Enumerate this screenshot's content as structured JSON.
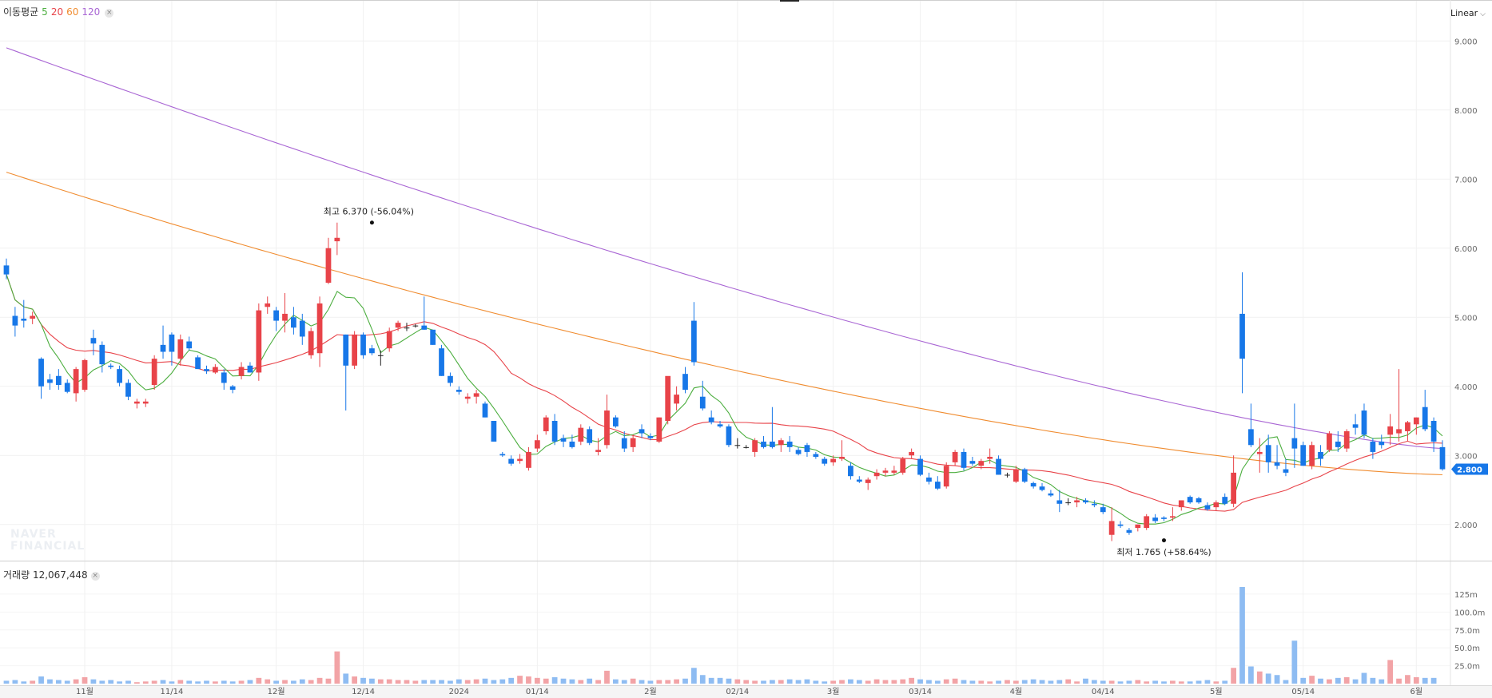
{
  "legend": {
    "label": "이동평균",
    "ma5": "5",
    "ma20": "20",
    "ma60": "60",
    "ma120": "120"
  },
  "volume_legend": {
    "label": "거래량",
    "value": "12,067,448"
  },
  "scale": {
    "label": "Linear"
  },
  "watermark": {
    "line1": "NAVER",
    "line2": "FINANCIAL"
  },
  "colors": {
    "up": "#e84349",
    "down": "#1777e8",
    "vol_up": "#f2a3a6",
    "vol_down": "#8ebcf2",
    "ma5": "#4cae3f",
    "ma20": "#e84349",
    "ma60": "#f08c30",
    "ma120": "#a966d4",
    "last_price_bg": "#1777e8"
  },
  "chart_data": {
    "type": "candlestick",
    "title": "",
    "price_axis": {
      "ylim": [
        1.5,
        9.5
      ],
      "ticks": [
        "2.000",
        "3.000",
        "4.000",
        "5.000",
        "6.000",
        "7.000",
        "8.000",
        "9.000"
      ]
    },
    "volume_axis": {
      "ylim": [
        0,
        145
      ],
      "ticks": [
        "25.0m",
        "50.0m",
        "75.0m",
        "100.0m",
        "125m"
      ]
    },
    "time_labels": [
      {
        "label": "11월",
        "index": 9
      },
      {
        "label": "11/14",
        "index": 19
      },
      {
        "label": "12월",
        "index": 31
      },
      {
        "label": "12/14",
        "index": 41
      },
      {
        "label": "2024",
        "index": 52
      },
      {
        "label": "01/14",
        "index": 61
      },
      {
        "label": "2월",
        "index": 74
      },
      {
        "label": "02/14",
        "index": 84
      },
      {
        "label": "3월",
        "index": 95
      },
      {
        "label": "03/14",
        "index": 105
      },
      {
        "label": "4월",
        "index": 116
      },
      {
        "label": "04/14",
        "index": 126
      },
      {
        "label": "5월",
        "index": 139
      },
      {
        "label": "05/14",
        "index": 149
      },
      {
        "label": "6월",
        "index": 162
      }
    ],
    "high_annotation": {
      "label": "최고 6.370 (-56.04%)",
      "index": 42,
      "value": 6.37
    },
    "low_annotation": {
      "label": "최저 1.765 (+58.64%)",
      "index": 133,
      "value": 1.765
    },
    "last_price": {
      "label": "2.800",
      "value": 2.8
    },
    "candles": [
      [
        5.75,
        5.85,
        5.55,
        5.62
      ],
      [
        5.02,
        5.15,
        4.72,
        4.88
      ],
      [
        4.98,
        5.25,
        4.85,
        4.95
      ],
      [
        4.98,
        5.08,
        4.9,
        5.02
      ],
      [
        4.4,
        4.42,
        3.82,
        4.0
      ],
      [
        4.1,
        4.18,
        3.95,
        4.05
      ],
      [
        4.15,
        4.25,
        3.95,
        4.02
      ],
      [
        4.05,
        4.1,
        3.9,
        3.92
      ],
      [
        3.9,
        4.28,
        3.78,
        4.25
      ],
      [
        3.95,
        4.4,
        3.92,
        4.38
      ],
      [
        4.7,
        4.82,
        4.45,
        4.62
      ],
      [
        4.6,
        4.65,
        4.2,
        4.32
      ],
      [
        4.3,
        4.33,
        4.25,
        4.28
      ],
      [
        4.25,
        4.3,
        4.0,
        4.05
      ],
      [
        4.05,
        4.1,
        3.8,
        3.85
      ],
      [
        3.75,
        3.82,
        3.68,
        3.78
      ],
      [
        3.75,
        3.82,
        3.7,
        3.78
      ],
      [
        4.02,
        4.45,
        3.95,
        4.4
      ],
      [
        4.6,
        4.88,
        4.4,
        4.5
      ],
      [
        4.75,
        4.78,
        4.3,
        4.5
      ],
      [
        4.4,
        4.75,
        4.3,
        4.68
      ],
      [
        4.65,
        4.72,
        4.52,
        4.55
      ],
      [
        4.42,
        4.45,
        4.25,
        4.25
      ],
      [
        4.25,
        4.3,
        4.18,
        4.22
      ],
      [
        4.2,
        4.32,
        4.18,
        4.28
      ],
      [
        4.2,
        4.25,
        3.95,
        4.05
      ],
      [
        4.0,
        4.02,
        3.9,
        3.95
      ],
      [
        4.15,
        4.35,
        4.1,
        4.28
      ],
      [
        4.3,
        4.35,
        4.2,
        4.2
      ],
      [
        4.2,
        5.2,
        4.08,
        5.1
      ],
      [
        5.15,
        5.3,
        5.05,
        5.2
      ],
      [
        5.1,
        5.15,
        4.8,
        4.95
      ],
      [
        4.95,
        5.35,
        4.78,
        5.05
      ],
      [
        5.0,
        5.15,
        4.75,
        4.85
      ],
      [
        4.95,
        5.05,
        4.6,
        4.72
      ],
      [
        4.45,
        4.85,
        4.4,
        4.8
      ],
      [
        4.48,
        5.3,
        4.28,
        5.2
      ],
      [
        5.5,
        6.15,
        5.48,
        6.0
      ],
      [
        6.1,
        6.37,
        5.9,
        6.15
      ],
      [
        4.75,
        4.75,
        3.65,
        4.3
      ],
      [
        4.3,
        4.8,
        4.25,
        4.75
      ],
      [
        4.75,
        4.78,
        4.4,
        4.45
      ],
      [
        4.55,
        4.6,
        4.45,
        4.48
      ],
      [
        4.45,
        4.52,
        4.3,
        4.45
      ],
      [
        4.55,
        4.85,
        4.5,
        4.8
      ],
      [
        4.85,
        4.95,
        4.8,
        4.92
      ],
      [
        4.85,
        4.92,
        4.8,
        4.85
      ],
      [
        4.88,
        4.9,
        4.85,
        4.88
      ],
      [
        4.88,
        5.3,
        4.82,
        4.82
      ],
      [
        4.82,
        4.82,
        4.6,
        4.6
      ],
      [
        4.55,
        4.6,
        4.15,
        4.15
      ],
      [
        4.15,
        4.2,
        4.0,
        4.05
      ],
      [
        3.95,
        4.0,
        3.88,
        3.92
      ],
      [
        3.82,
        3.9,
        3.75,
        3.85
      ],
      [
        3.85,
        3.95,
        3.75,
        3.9
      ],
      [
        3.75,
        3.78,
        3.55,
        3.55
      ],
      [
        3.5,
        3.5,
        3.2,
        3.2
      ],
      [
        3.02,
        3.05,
        2.98,
        3.0
      ],
      [
        2.95,
        3.0,
        2.85,
        2.88
      ],
      [
        2.92,
        3.02,
        2.88,
        2.95
      ],
      [
        2.82,
        3.12,
        2.78,
        3.05
      ],
      [
        3.1,
        3.3,
        3.05,
        3.22
      ],
      [
        3.35,
        3.58,
        3.3,
        3.55
      ],
      [
        3.5,
        3.6,
        3.15,
        3.2
      ],
      [
        3.25,
        3.3,
        3.12,
        3.2
      ],
      [
        3.2,
        3.3,
        3.1,
        3.12
      ],
      [
        3.2,
        3.45,
        3.15,
        3.4
      ],
      [
        3.38,
        3.42,
        3.15,
        3.18
      ],
      [
        3.05,
        3.25,
        3.0,
        3.08
      ],
      [
        3.15,
        3.88,
        3.1,
        3.65
      ],
      [
        3.55,
        3.58,
        3.4,
        3.42
      ],
      [
        3.25,
        3.35,
        3.05,
        3.1
      ],
      [
        3.12,
        3.3,
        3.05,
        3.25
      ],
      [
        3.38,
        3.45,
        3.25,
        3.32
      ],
      [
        3.28,
        3.32,
        3.22,
        3.25
      ],
      [
        3.2,
        3.55,
        3.18,
        3.55
      ],
      [
        3.5,
        4.0,
        3.45,
        4.15
      ],
      [
        3.75,
        4.0,
        3.65,
        3.88
      ],
      [
        4.18,
        4.28,
        3.9,
        3.95
      ],
      [
        4.95,
        5.22,
        4.3,
        4.35
      ],
      [
        3.85,
        4.08,
        3.65,
        3.68
      ],
      [
        3.55,
        3.65,
        3.45,
        3.48
      ],
      [
        3.45,
        3.5,
        3.4,
        3.42
      ],
      [
        3.42,
        3.45,
        3.12,
        3.15
      ],
      [
        3.15,
        3.25,
        3.1,
        3.15
      ],
      [
        3.12,
        3.15,
        3.1,
        3.12
      ],
      [
        3.05,
        3.25,
        2.98,
        3.22
      ],
      [
        3.2,
        3.28,
        3.1,
        3.12
      ],
      [
        3.2,
        3.7,
        3.1,
        3.12
      ],
      [
        3.15,
        3.25,
        3.05,
        3.22
      ],
      [
        3.2,
        3.28,
        3.05,
        3.12
      ],
      [
        3.08,
        3.12,
        3.0,
        3.02
      ],
      [
        3.15,
        3.18,
        2.98,
        3.05
      ],
      [
        3.02,
        3.05,
        2.95,
        2.98
      ],
      [
        2.95,
        2.98,
        2.85,
        2.88
      ],
      [
        2.9,
        3.0,
        2.85,
        2.95
      ],
      [
        2.95,
        3.22,
        2.92,
        2.98
      ],
      [
        2.85,
        2.9,
        2.65,
        2.7
      ],
      [
        2.65,
        2.7,
        2.6,
        2.62
      ],
      [
        2.6,
        2.68,
        2.5,
        2.65
      ],
      [
        2.7,
        2.8,
        2.65,
        2.75
      ],
      [
        2.75,
        2.82,
        2.7,
        2.78
      ],
      [
        2.75,
        2.85,
        2.72,
        2.78
      ],
      [
        2.75,
        2.98,
        2.72,
        2.95
      ],
      [
        3.0,
        3.1,
        2.95,
        3.05
      ],
      [
        2.95,
        3.0,
        2.7,
        2.72
      ],
      [
        2.68,
        2.75,
        2.58,
        2.62
      ],
      [
        2.62,
        2.7,
        2.5,
        2.52
      ],
      [
        2.55,
        2.9,
        2.52,
        2.85
      ],
      [
        2.9,
        3.08,
        2.85,
        3.05
      ],
      [
        3.05,
        3.1,
        2.78,
        2.82
      ],
      [
        2.92,
        2.98,
        2.85,
        2.88
      ],
      [
        2.85,
        2.95,
        2.8,
        2.92
      ],
      [
        2.95,
        3.1,
        2.88,
        2.98
      ],
      [
        2.95,
        3.0,
        2.72,
        2.72
      ],
      [
        2.72,
        2.75,
        2.68,
        2.72
      ],
      [
        2.62,
        2.85,
        2.6,
        2.8
      ],
      [
        2.8,
        2.82,
        2.6,
        2.62
      ],
      [
        2.6,
        2.62,
        2.52,
        2.55
      ],
      [
        2.55,
        2.6,
        2.48,
        2.5
      ],
      [
        2.45,
        2.5,
        2.4,
        2.42
      ],
      [
        2.35,
        2.5,
        2.18,
        2.3
      ],
      [
        2.32,
        2.38,
        2.28,
        2.32
      ],
      [
        2.32,
        2.4,
        2.25,
        2.35
      ],
      [
        2.35,
        2.38,
        2.3,
        2.32
      ],
      [
        2.3,
        2.35,
        2.25,
        2.28
      ],
      [
        2.25,
        2.3,
        2.15,
        2.18
      ],
      [
        1.85,
        2.25,
        1.76,
        2.05
      ],
      [
        2.0,
        2.05,
        1.95,
        1.98
      ],
      [
        1.92,
        1.95,
        1.85,
        1.88
      ],
      [
        1.95,
        2.0,
        1.9,
        2.0
      ],
      [
        1.95,
        2.15,
        1.92,
        2.12
      ],
      [
        2.1,
        2.15,
        2.02,
        2.05
      ],
      [
        2.1,
        2.12,
        2.05,
        2.08
      ],
      [
        2.1,
        2.25,
        2.05,
        2.12
      ],
      [
        2.25,
        2.35,
        2.2,
        2.35
      ],
      [
        2.4,
        2.42,
        2.3,
        2.32
      ],
      [
        2.38,
        2.4,
        2.3,
        2.32
      ],
      [
        2.28,
        2.32,
        2.2,
        2.22
      ],
      [
        2.25,
        2.35,
        2.2,
        2.32
      ],
      [
        2.4,
        2.45,
        2.28,
        2.3
      ],
      [
        2.3,
        3.0,
        2.25,
        2.75
      ],
      [
        5.05,
        5.65,
        3.9,
        4.4
      ],
      [
        3.38,
        3.75,
        3.12,
        3.15
      ],
      [
        3.02,
        3.25,
        2.75,
        3.05
      ],
      [
        3.15,
        3.3,
        2.75,
        2.9
      ],
      [
        2.9,
        3.15,
        2.8,
        2.85
      ],
      [
        2.8,
        2.95,
        2.7,
        2.75
      ],
      [
        3.25,
        3.75,
        2.82,
        3.1
      ],
      [
        3.15,
        3.2,
        2.85,
        2.85
      ],
      [
        2.85,
        3.2,
        2.8,
        3.15
      ],
      [
        3.05,
        3.15,
        2.85,
        2.95
      ],
      [
        3.08,
        3.35,
        3.05,
        3.32
      ],
      [
        3.2,
        3.35,
        3.05,
        3.12
      ],
      [
        3.1,
        3.38,
        3.05,
        3.35
      ],
      [
        3.45,
        3.6,
        3.3,
        3.4
      ],
      [
        3.65,
        3.75,
        3.25,
        3.3
      ],
      [
        3.2,
        3.25,
        2.95,
        3.05
      ],
      [
        3.2,
        3.3,
        3.1,
        3.15
      ],
      [
        3.3,
        3.6,
        3.15,
        3.42
      ],
      [
        3.32,
        4.25,
        3.2,
        3.38
      ],
      [
        3.35,
        3.5,
        3.2,
        3.48
      ],
      [
        3.45,
        3.55,
        3.3,
        3.55
      ],
      [
        3.7,
        3.95,
        3.35,
        3.38
      ],
      [
        3.5,
        3.55,
        3.05,
        3.2
      ],
      [
        3.12,
        3.22,
        2.78,
        2.8
      ]
    ],
    "volume": [
      4,
      5,
      3,
      4,
      10,
      6,
      5,
      4,
      6,
      9,
      6,
      4,
      5,
      3,
      4,
      2,
      3,
      4,
      5,
      3,
      5,
      4,
      3,
      4,
      3,
      4,
      3,
      4,
      5,
      8,
      6,
      4,
      5,
      4,
      6,
      5,
      8,
      7,
      45,
      14,
      10,
      8,
      7,
      6,
      6,
      5,
      5,
      4,
      5,
      5,
      5,
      4,
      6,
      5,
      6,
      7,
      5,
      6,
      8,
      11,
      10,
      8,
      7,
      9,
      7,
      6,
      5,
      7,
      5,
      18,
      6,
      5,
      7,
      5,
      4,
      5,
      5,
      6,
      7,
      22,
      12,
      8,
      8,
      7,
      6,
      5,
      4,
      4,
      5,
      5,
      6,
      5,
      6,
      4,
      3,
      4,
      5,
      6,
      5,
      4,
      6,
      5,
      5,
      6,
      8,
      6,
      5,
      4,
      6,
      7,
      5,
      4,
      4,
      3,
      4,
      5,
      4,
      5,
      6,
      5,
      4,
      5,
      6,
      3,
      7,
      5,
      4,
      4,
      3,
      4,
      5,
      3,
      4,
      3,
      4,
      3,
      3,
      4,
      5,
      3,
      4,
      22,
      135,
      24,
      17,
      14,
      12,
      5,
      60,
      8,
      11,
      7,
      6,
      8,
      9,
      6,
      15,
      8,
      6,
      33,
      7,
      12,
      9,
      8,
      8
    ]
  }
}
